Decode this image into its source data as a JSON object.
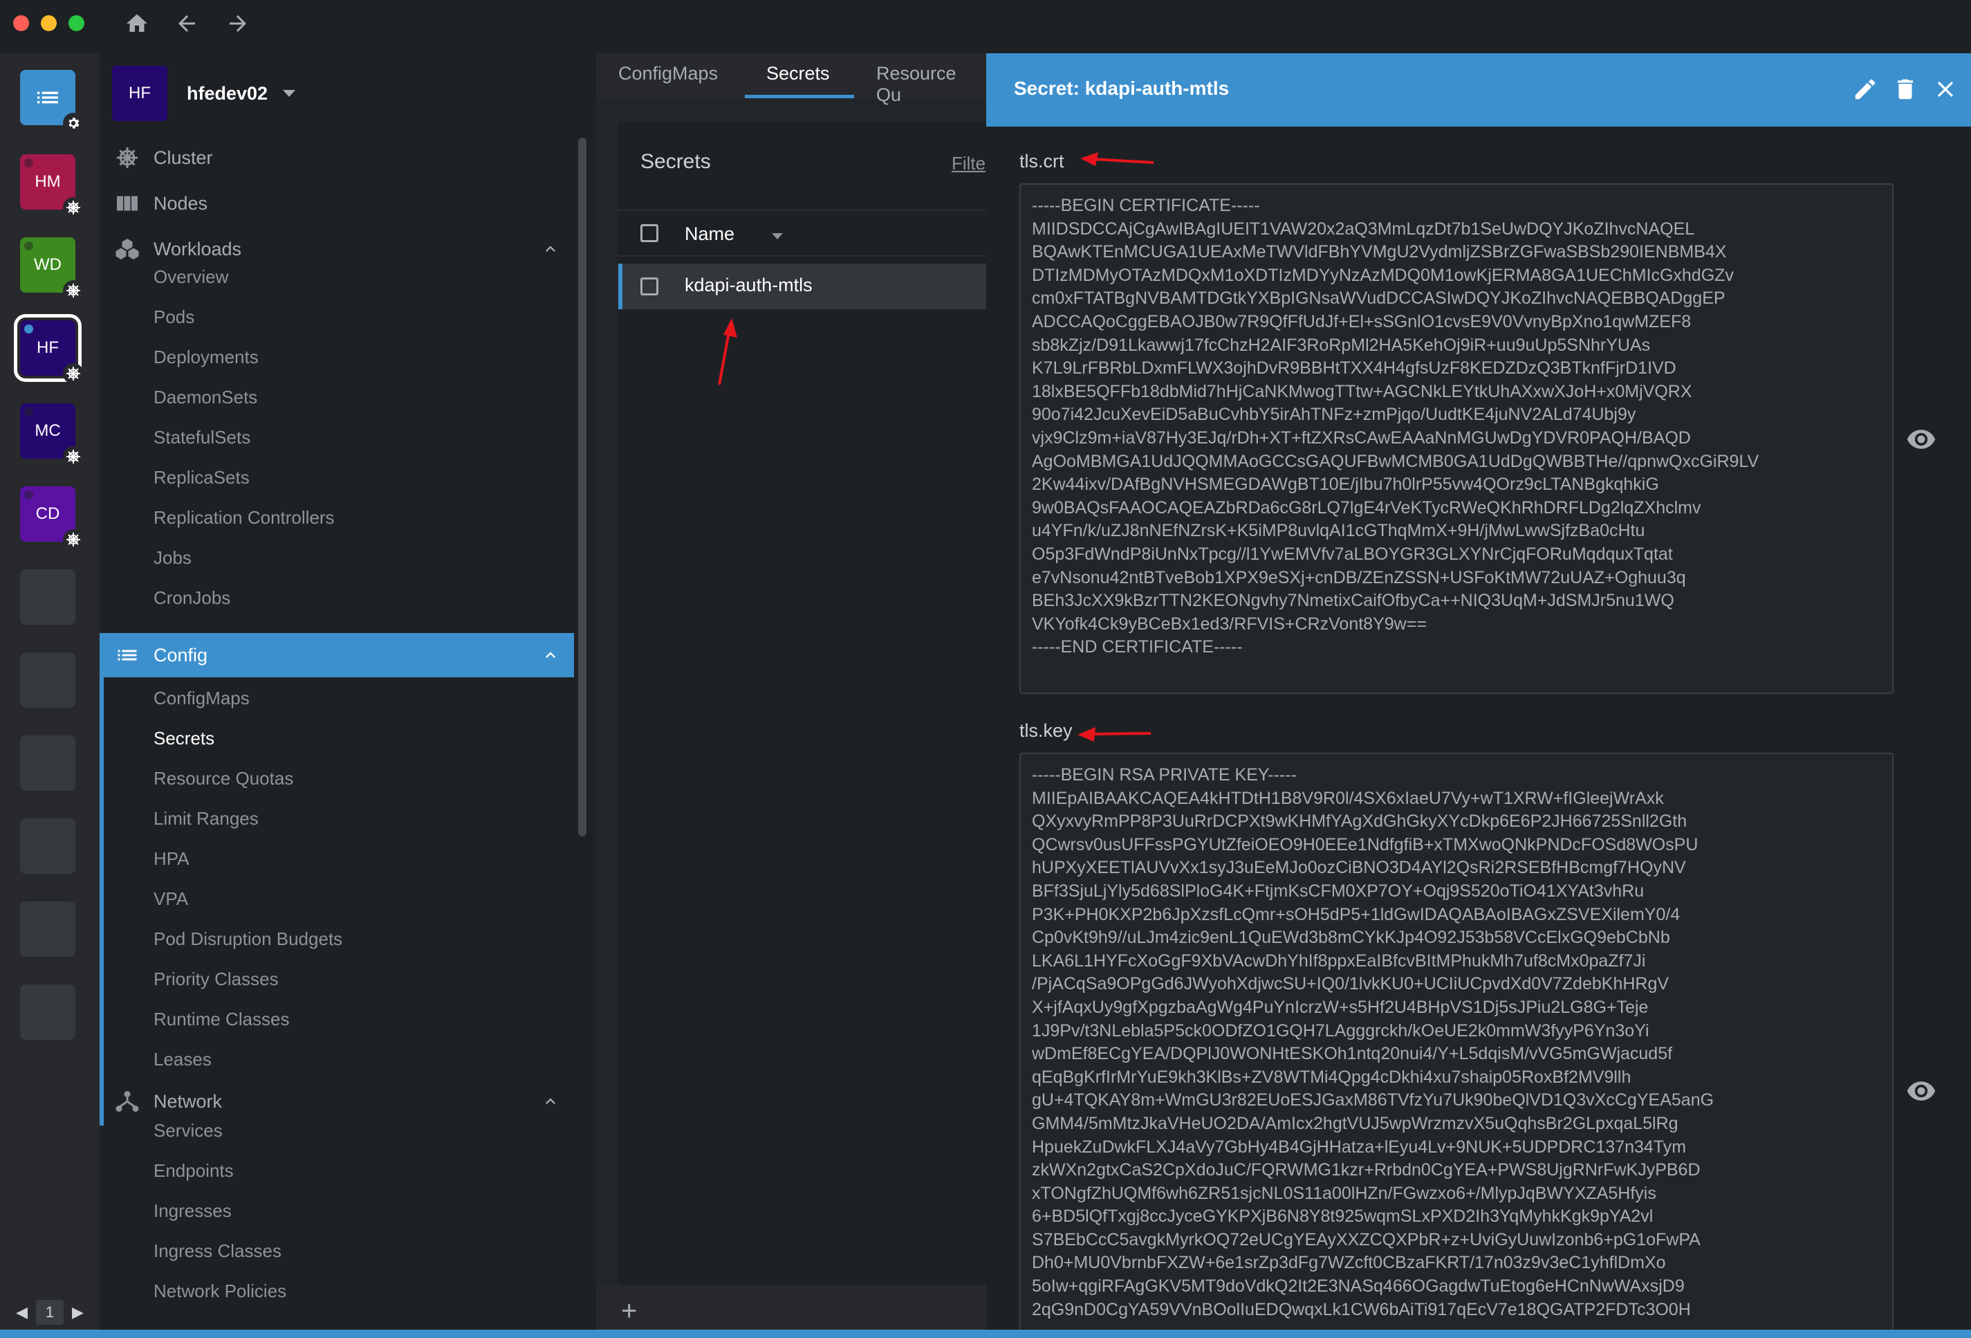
{
  "hotbar": {
    "items": [
      {
        "initials": "HM",
        "color": "#a6194b"
      },
      {
        "initials": "WD",
        "color": "#3d8b1f"
      },
      {
        "initials": "HF",
        "color": "#25086e"
      },
      {
        "initials": "MC",
        "color": "#25086e"
      },
      {
        "initials": "CD",
        "color": "#5b12a3"
      }
    ],
    "page": "1"
  },
  "cluster": {
    "initials": "HF",
    "name": "hfedev02"
  },
  "sidebar": {
    "cluster": "Cluster",
    "nodes": "Nodes",
    "workloads": {
      "label": "Workloads",
      "items": [
        "Overview",
        "Pods",
        "Deployments",
        "DaemonSets",
        "StatefulSets",
        "ReplicaSets",
        "Replication Controllers",
        "Jobs",
        "CronJobs"
      ]
    },
    "config": {
      "label": "Config",
      "items": [
        "ConfigMaps",
        "Secrets",
        "Resource Quotas",
        "Limit Ranges",
        "HPA",
        "VPA",
        "Pod Disruption Budgets",
        "Priority Classes",
        "Runtime Classes",
        "Leases"
      ]
    },
    "network": {
      "label": "Network",
      "items": [
        "Services",
        "Endpoints",
        "Ingresses",
        "Ingress Classes",
        "Network Policies"
      ]
    }
  },
  "main": {
    "tabs": [
      "ConfigMaps",
      "Secrets",
      "Resource Qu"
    ],
    "panel_title": "Secrets",
    "filter": "Filte",
    "column_name": "Name",
    "rows": [
      "kdapi-auth-mtls"
    ]
  },
  "drawer": {
    "title": "Secret: kdapi-auth-mtls",
    "tls_crt_label": "tls.crt",
    "tls_crt": "-----BEGIN CERTIFICATE-----\nMIIDSDCCAjCgAwIBAgIUEIT1VAW20x2aQ3MmLqzDt7b1SeUwDQYJKoZIhvcNAQEL\nBQAwKTEnMCUGA1UEAxMeTWVldFBhYVMgU2VydmljZSBrZGFwaSBSb290IENBMB4X\nDTIzMDMyOTAzMDQxM1oXDTIzMDYyNzAzMDQ0M1owKjERMA8GA1UEChMIcGxhdGZv\ncm0xFTATBgNVBAMTDGtkYXBpIGNsaWVudDCCASIwDQYJKoZIhvcNAQEBBQADggEP\nADCCAQoCggEBAOJB0w7R9QfFfUdJf+El+sSGnlO1cvsE9V0VvnyBpXno1qwMZEF8\nsb8kZjz/D91Lkawwj17fcChzH2AIF3RoRpMl2HA5KehOj9iR+uu9uUp5SNhrYUAs\nK7L9LrFBRbLDxmFLWX3ojhDvR9BBHtTXX4H4gfsUzF8KEDZDzQ3BTknfFjrD1IVD\n18lxBE5QFFb18dbMid7hHjCaNKMwogTTtw+AGCNkLEYtkUhAXxwXJoH+x0MjVQRX\n90o7i42JcuXevEiD5aBuCvhbY5irAhTNFz+zmPjqo/UudtKE4juNV2ALd74Ubj9y\nvjx9Clz9m+iaV87Hy3EJq/rDh+XT+ftZXRsCAwEAAaNnMGUwDgYDVR0PAQH/BAQD\nAgOoMBMGA1UdJQQMMAoGCCsGAQUFBwMCMB0GA1UdDgQWBBTHe//qpnwQxcGiR9LV\n2Kw44ixv/DAfBgNVHSMEGDAWgBT10E/jIbu7h0lrP55vw4QOrz9cLTANBgkqhkiG\n9w0BAQsFAAOCAQEAZbRDa6cG8rLQ7lgE4rVeKTycRWeQKhRhDRFLDg2lqZXhclmv\nu4YFn/k/uZJ8nNEfNZrsK+K5iMP8uvlqAI1cGThqMmX+9H/jMwLwwSjfzBa0cHtu\nO5p3FdWndP8iUnNxTpcg//l1YwEMVfv7aLBOYGR3GLXYNrCjqFORuMqdquxTqtat\ne7vNsonu42ntBTveBob1XPX9eSXj+cnDB/ZEnZSSN+USFoKtMW72uUAZ+Oghuu3q\nBEh3JcXX9kBzrTTN2KEONgvhy7NmetixCaifOfbyCa++NIQ3UqM+JdSMJr5nu1WQ\nVKYofk4Ck9yBCeBx1ed3/RFVIS+CRzVont8Y9w==\n-----END CERTIFICATE-----",
    "tls_key_label": "tls.key",
    "tls_key": "-----BEGIN RSA PRIVATE KEY-----\nMIIEpAIBAAKCAQEA4kHTDtH1B8V9R0l/4SX6xIaeU7Vy+wT1XRW+fIGleejWrAxk\nQXyxvyRmPP8P3UuRrDCPXt9wKHMfYAgXdGhGkyXYcDkp6E6P2JH66725Snll2Gth\nQCwrsv0usUFFssPGYUtZfeiOEO9H0EEe1NdfgfiB+xTMXwoQNkPNDcFOSd8WOsPU\nhUPXyXEETlAUVvXx1syJ3uEeMJo0ozCiBNO3D4AYl2QsRi2RSEBfHBcmgf7HQyNV\nBFf3SjuLjYly5d68SlPloG4K+FtjmKsCFM0XP7OY+Oqj9S520oTiO41XYAt3vhRu\nP3K+PH0KXP2b6JpXzsfLcQmr+sOH5dP5+1ldGwIDAQABAoIBAGxZSVEXilemY0/4\nCp0vKt9h9//uLJm4zic9enL1QuEWd3b8mCYkKJp4O92J53b58VCcElxGQ9ebCbNb\nLKA6L1HYFcXoGgF9XbVAcwDhYhIf8ppxEaIBfcvBItMPhukMh7uf8cMx0paZf7Ji\n/PjACqSa9OPgGd6JWyohXdjwcSU+IQ0/1lvkKU0+UCIiUCpvdXd0V7ZdebKhHRgV\nX+jfAqxUy9gfXpgzbaAgWg4PuYnIcrzW+s5Hf2U4BHpVS1Dj5sJPiu2LG8G+Teje\n1J9Pv/t3NLebla5P5ck0ODfZO1GQH7LAgggrckh/kOeUE2k0mmW3fyyP6Yn3oYi\nwDmEf8ECgYEA/DQPlJ0WONHtESKOh1ntq20nui4/Y+L5dqisM/vVG5mGWjacud5f\nqEqBgKrfIrMrYuE9kh3KlBs+ZV8WTMi4Qpg4cDkhi4xu7shaip05RoxBf2MV9llh\ngU+4TQKAY8m+WmGU3r82EUoESJGaxM86TVfzYu7Uk90beQlVD1Q3vXcCgYEA5anG\nGMM4/5mMtzJkaVHeUO2DA/AmIcx2hgtVUJ5wpWrzmzvX5uQqhsBr2GLpxqaL5lRg\nHpuekZuDwkFLXJ4aVy7GbHy4B4GjHHatza+lEyu4Lv+9NUK+5UDPDRC137n34Tym\nzkWXn2gtxCaS2CpXdoJuC/FQRWMG1kzr+Rrbdn0CgYEA+PWS8UjgRNrFwKJyPB6D\nxTONgfZhUQMf6wh6ZR51sjcNL0S11a00lHZn/FGwzxo6+/MlypJqBWYXZA5Hfyis\n6+BD5lQfTxgj8ccJyceGYKPXjB6N8Y8t925wqmSLxPXD2Ih3YqMyhkKgk9pYA2vl\nS7BEbCcC5avgkMyrkOQ72eUCgYEAyXXZCQXPbR+z+UviGyUuwIzonb6+pG1oFwPA\nDh0+MU0VbrnbFXZW+6e1srZp3dFg7WZcft0CBzaFKRT/17n03z9v3eC1yhflDmXo\n5oIw+qgiRFAgGKV5MT9doVdkQ2It2E3NASq466OGagdwTuEtog6eHCnNwWAxsjD9\n2qG9nD0CgYA59VVnBOolIuEDQwqxLk1CW6bAiTi917qEcV7e18QGATP2FDTc3O0H"
  }
}
